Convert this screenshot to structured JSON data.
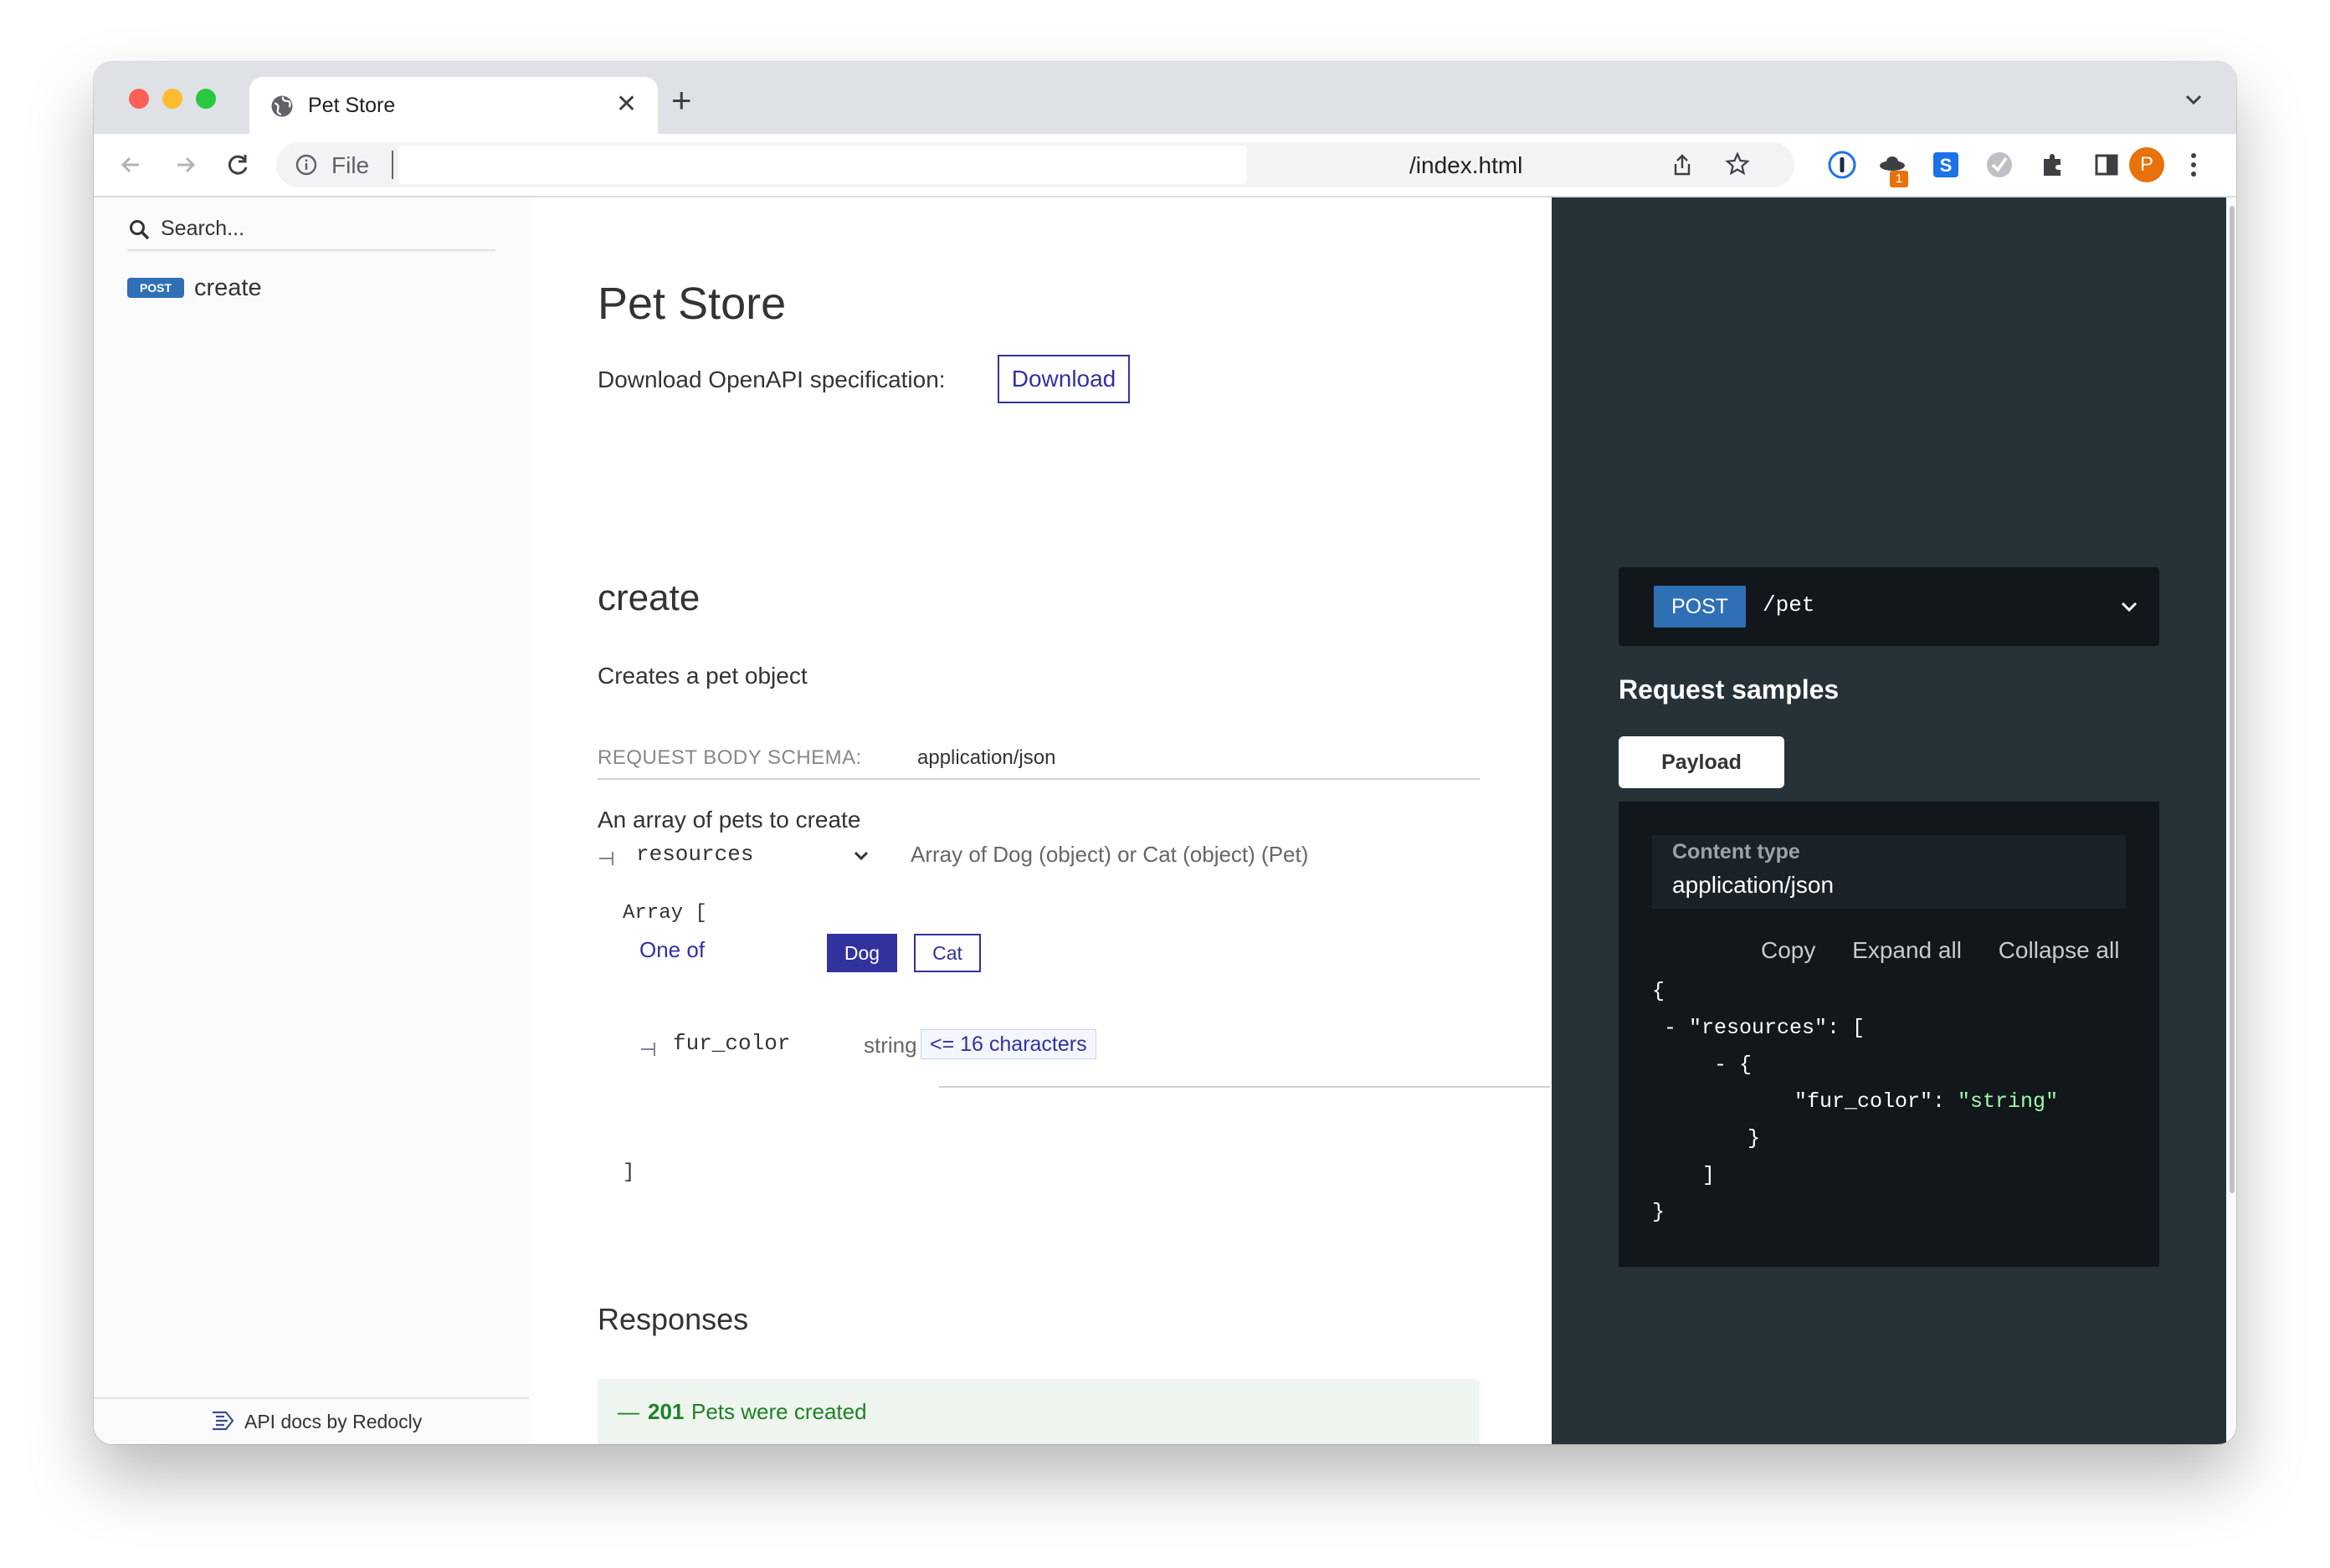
{
  "browser": {
    "tab_title": "Pet Store",
    "omnibox_scheme": "File",
    "omnibox_url": "/index.html",
    "profile_initial": "P",
    "extension_badge": "1"
  },
  "sidebar": {
    "search_placeholder": "Search...",
    "items": [
      {
        "method": "POST",
        "label": "create"
      }
    ],
    "footer": "API docs by Redocly"
  },
  "main": {
    "title": "Pet Store",
    "download_label": "Download OpenAPI specification:",
    "download_button": "Download",
    "operation_title": "create",
    "operation_description": "Creates a pet object",
    "request_body_label": "REQUEST BODY SCHEMA:",
    "request_body_type": "application/json",
    "schema_description": "An array of pets to create",
    "property": {
      "name": "resources",
      "type": "Array of Dog (object) or Cat (object) (Pet)"
    },
    "array_open": "Array [",
    "one_of_label": "One of",
    "one_of_options": [
      "Dog",
      "Cat"
    ],
    "fur_color": {
      "name": "fur_color",
      "type": "string",
      "constraint": "<= 16 characters"
    },
    "array_close": "]",
    "responses_title": "Responses",
    "responses": [
      {
        "dash": "—",
        "code": "201",
        "description": "Pets were created"
      }
    ]
  },
  "right_panel": {
    "method": "POST",
    "path": "/pet",
    "request_samples_title": "Request samples",
    "payload_tab": "Payload",
    "content_type_label": "Content type",
    "content_type_value": "application/json",
    "actions": [
      "Copy",
      "Expand all",
      "Collapse all"
    ],
    "code": {
      "l1": "{",
      "l2_prefix": "- ",
      "l2_key": "\"resources\"",
      "l2_rest": ": [",
      "l3": "- {",
      "l4_key": "\"fur_color\"",
      "l4_sep": ": ",
      "l4_value": "\"string\"",
      "l5": "}",
      "l6": "]",
      "l7": "}"
    }
  },
  "colors": {
    "accent": "#32329f",
    "post_badge": "#2f6fb6",
    "success": "#1d8127",
    "right_panel": "#263238",
    "code_string": "#a0fbaa"
  }
}
